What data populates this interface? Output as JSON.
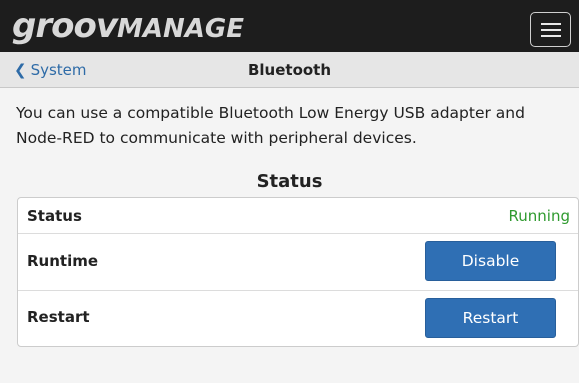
{
  "header": {
    "logo_part1": "groov",
    "logo_part2": "MANAGE",
    "menu_icon": "hamburger-menu-icon"
  },
  "nav": {
    "back_label": "System",
    "back_icon": "chevron-left-icon",
    "page_title": "Bluetooth"
  },
  "intro_text": "You can use a compatible Bluetooth Low Energy USB adapter and Node-RED to communicate with peripheral devices.",
  "status_section": {
    "title": "Status",
    "rows": [
      {
        "label": "Status",
        "value": "Running"
      },
      {
        "label": "Runtime",
        "button": "Disable"
      },
      {
        "label": "Restart",
        "button": "Restart"
      }
    ]
  },
  "colors": {
    "topbar": "#1d1d1d",
    "accent_blue": "#2f6fb4",
    "link_blue": "#2e6ba7",
    "status_green": "#2f9a2f"
  }
}
